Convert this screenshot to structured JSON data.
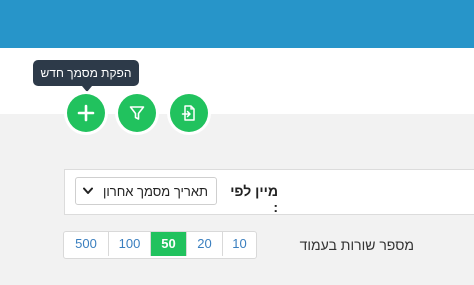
{
  "tooltip": {
    "text": "הפקת מסמך חדש"
  },
  "toolbar": {
    "buttons": [
      {
        "name": "add-document-button",
        "icon": "plus-icon"
      },
      {
        "name": "filter-button",
        "icon": "filter-icon"
      },
      {
        "name": "export-button",
        "icon": "file-export-icon"
      }
    ]
  },
  "sort": {
    "label": "מיין לפי :",
    "selected": "תאריך מסמך אחרון",
    "icon": "chevron-down-icon"
  },
  "pagination": {
    "label": "מספר שורות בעמוד",
    "options": [
      "500",
      "100",
      "50",
      "20",
      "10"
    ],
    "active": "50"
  },
  "colors": {
    "header": "#2795c9",
    "accent": "#21c25e",
    "tooltip": "#2d3a49",
    "link": "#3a7fbf"
  }
}
